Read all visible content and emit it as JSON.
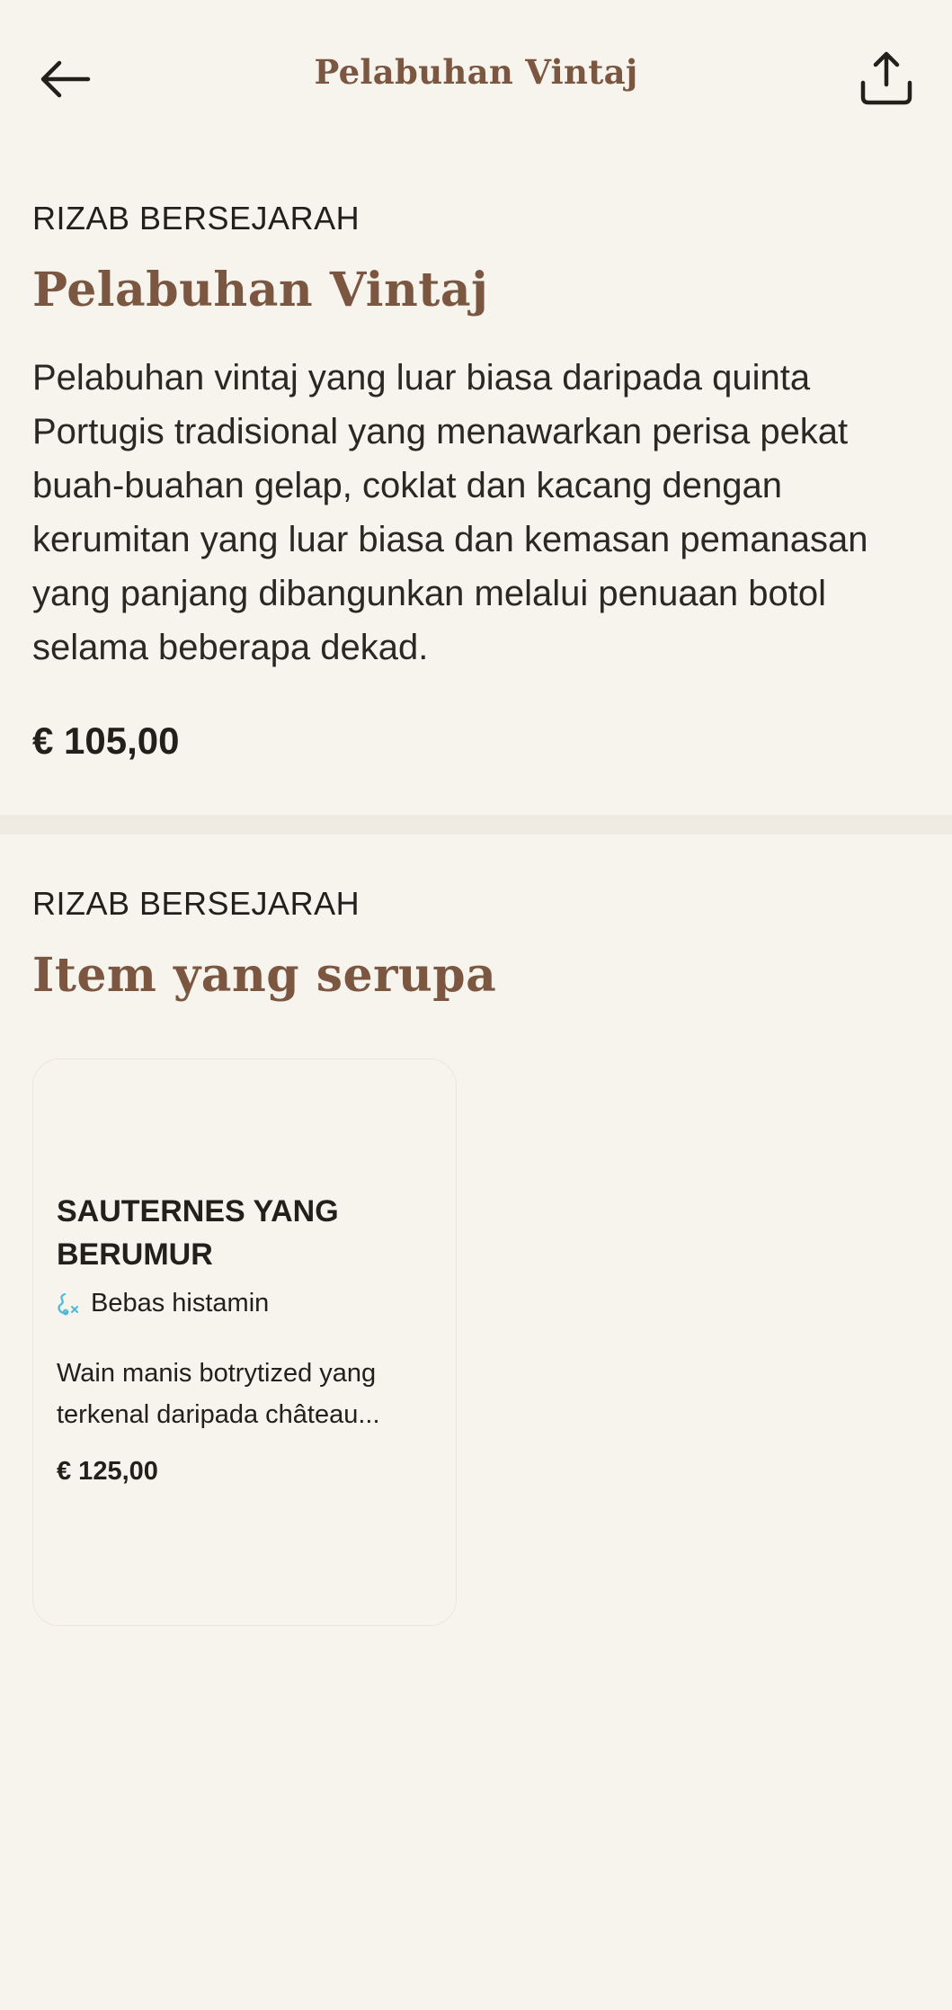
{
  "header": {
    "title": "Pelabuhan Vintaj",
    "back_icon": "arrow-left-icon",
    "share_icon": "share-icon"
  },
  "product": {
    "eyebrow": "RIZAB BERSEJARAH",
    "title": "Pelabuhan Vintaj",
    "description": "Pelabuhan vintaj yang luar biasa daripada quinta Portugis tradisional yang menawarkan perisa pekat buah-buahan gelap, coklat dan kacang dengan kerumitan yang luar biasa dan kemasan pemanasan yang panjang dibangunkan melalui penuaan botol selama beberapa dekad.",
    "price": "€ 105,00"
  },
  "similar": {
    "eyebrow": "RIZAB BERSEJARAH",
    "title": "Item yang serupa",
    "items": [
      {
        "name": "SAUTERNES YANG BERUMUR",
        "badge": "Bebas histamin",
        "badge_icon": "histamine-free-icon",
        "description": "Wain manis botrytized yang terkenal daripada château...",
        "price": "€ 125,00"
      }
    ]
  },
  "colors": {
    "background": "#f7f4ee",
    "accent": "#7b5640",
    "text": "#22201b",
    "divider": "#efebe3",
    "badge_icon": "#4fb8d6"
  }
}
